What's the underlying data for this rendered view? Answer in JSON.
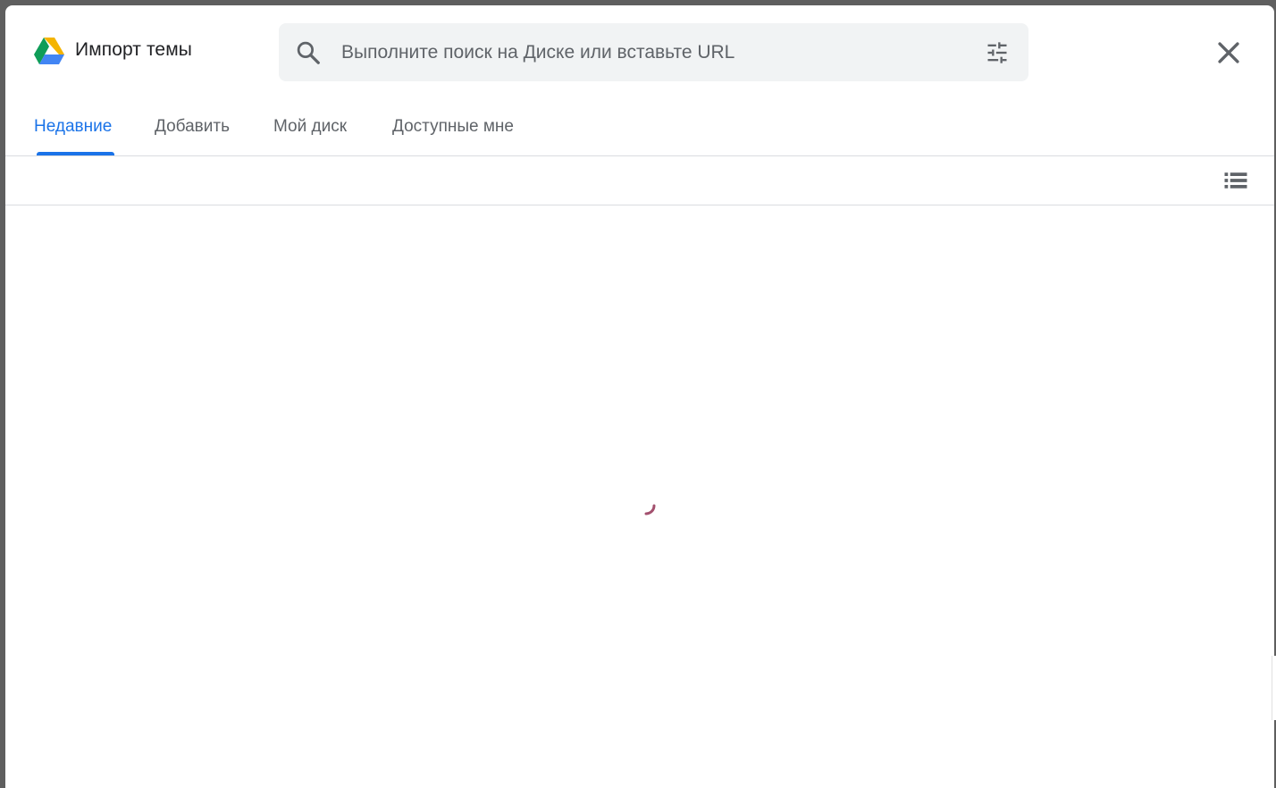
{
  "dialog": {
    "title": "Импорт темы",
    "close_icon": "close-icon"
  },
  "search": {
    "placeholder": "Выполните поиск на Диске или вставьте URL",
    "value": "",
    "search_icon": "search-icon",
    "filter_icon": "tune-icon"
  },
  "tabs": [
    {
      "label": "Недавние",
      "active": true
    },
    {
      "label": "Добавить",
      "active": false
    },
    {
      "label": "Мой диск",
      "active": false
    },
    {
      "label": "Доступные мне",
      "active": false
    }
  ],
  "toolbar": {
    "view_icon": "list-view-icon"
  },
  "content": {
    "loading_icon": "loading-spinner-icon"
  },
  "colors": {
    "accent": "#1a73e8",
    "spinner": "#a3506e",
    "drive_green": "#0f9d58",
    "drive_yellow": "#f4b400",
    "drive_blue": "#4285f4"
  }
}
